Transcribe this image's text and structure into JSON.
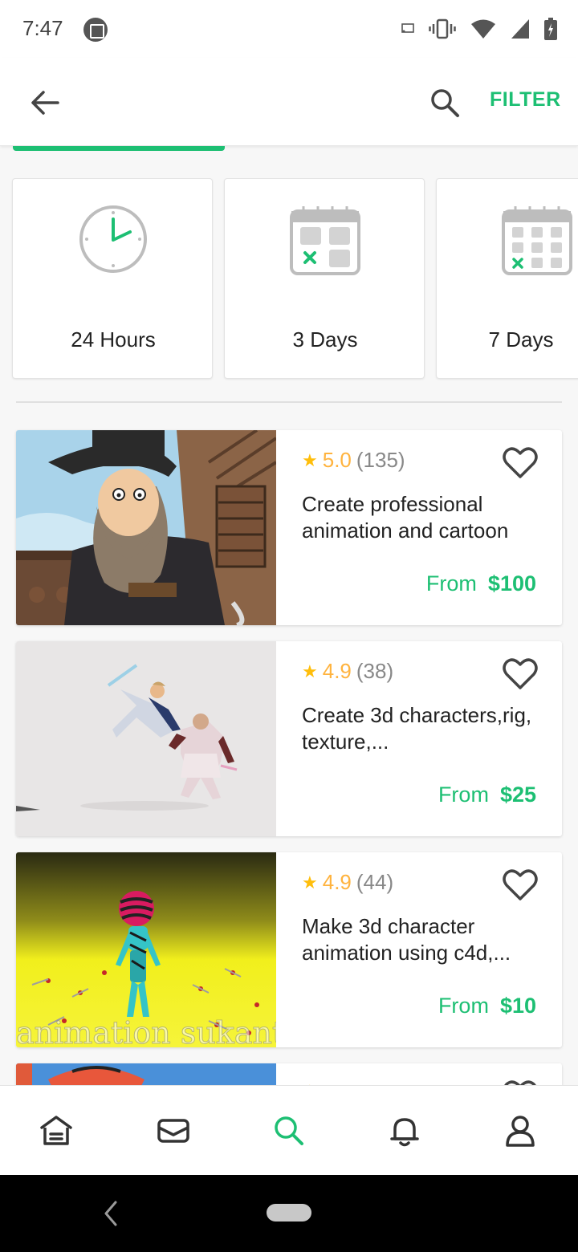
{
  "status_bar": {
    "time": "7:47"
  },
  "app_bar": {
    "filter_label": "FILTER"
  },
  "delivery_options": [
    {
      "label": "24 Hours",
      "icon": "clock-icon"
    },
    {
      "label": "3 Days",
      "icon": "calendar-icon"
    },
    {
      "label": "7 Days",
      "icon": "calendar-week-icon"
    }
  ],
  "gigs": [
    {
      "rating": "5.0",
      "reviews": "(135)",
      "title": "Create professional animation and cartoon",
      "price_prefix": "From",
      "price": "$100"
    },
    {
      "rating": "4.9",
      "reviews": "(38)",
      "title": "Create 3d characters,rig, texture,...",
      "price_prefix": "From",
      "price": "$25"
    },
    {
      "rating": "4.9",
      "reviews": "(44)",
      "title": "Make 3d character animation using c4d,...",
      "price_prefix": "From",
      "price": "$10"
    }
  ],
  "colors": {
    "accent": "#1dbf73",
    "star": "#ffbe0b"
  }
}
